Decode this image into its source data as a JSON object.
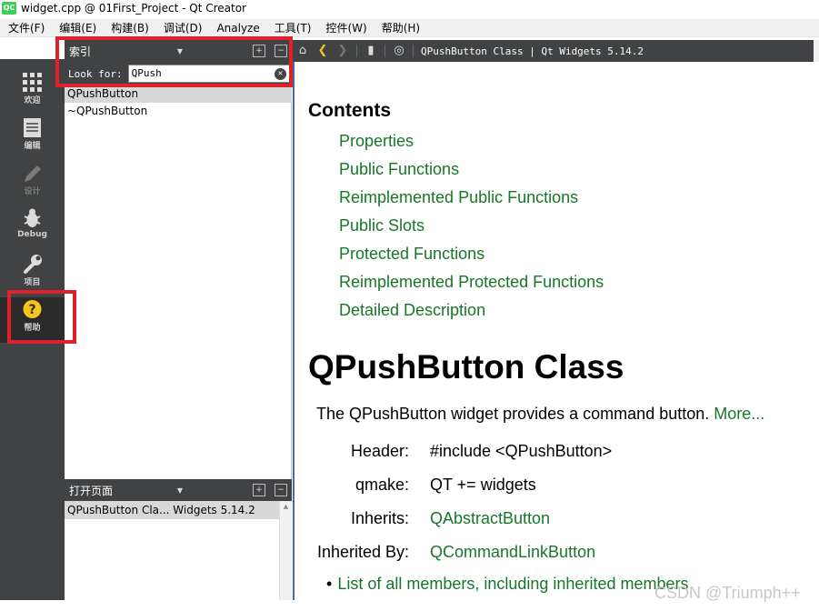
{
  "window": {
    "icon_text": "QC",
    "title": "widget.cpp @ 01First_Project - Qt Creator"
  },
  "menu": [
    "文件(F)",
    "编辑(E)",
    "构建(B)",
    "调试(D)",
    "Analyze",
    "工具(T)",
    "控件(W)",
    "帮助(H)"
  ],
  "modes": [
    {
      "label": "欢迎",
      "icon": "grid-icon"
    },
    {
      "label": "编辑",
      "icon": "document-icon"
    },
    {
      "label": "设计",
      "icon": "pen-icon"
    },
    {
      "label": "Debug",
      "icon": "bug-icon"
    },
    {
      "label": "项目",
      "icon": "wrench-icon"
    },
    {
      "label": "帮助",
      "icon": "help-icon"
    }
  ],
  "sidebar": {
    "pane_title": "索引",
    "look_for_label": "Look for:",
    "search_value": "QPush",
    "results": [
      "QPushButton",
      "~QPushButton"
    ],
    "open_pages_title": "打开页面",
    "open_pages": [
      "QPushButton Cla... Widgets 5.14.2"
    ]
  },
  "helpbar": {
    "title": "QPushButton Class | Qt Widgets 5.14.2"
  },
  "doc": {
    "contents_heading": "Contents",
    "toc": [
      "Properties",
      "Public Functions",
      "Reimplemented Public Functions",
      "Public Slots",
      "Protected Functions",
      "Reimplemented Protected Functions",
      "Detailed Description"
    ],
    "class_title": "QPushButton Class",
    "brief": "The QPushButton widget provides a command button.",
    "more": "More...",
    "info": [
      {
        "label": "Header:",
        "value": "#include <QPushButton>",
        "link": false
      },
      {
        "label": "qmake:",
        "value": "QT += widgets",
        "link": false
      },
      {
        "label": "Inherits:",
        "value": "QAbstractButton",
        "link": true
      },
      {
        "label": "Inherited By:",
        "value": "QCommandLinkButton",
        "link": true
      }
    ],
    "members_link": "List of all members, including inherited members"
  },
  "watermark": "CSDN @Triumph++",
  "colors": {
    "link": "#17762a",
    "highlight": "#e0202a",
    "panel_dark": "#404244"
  }
}
